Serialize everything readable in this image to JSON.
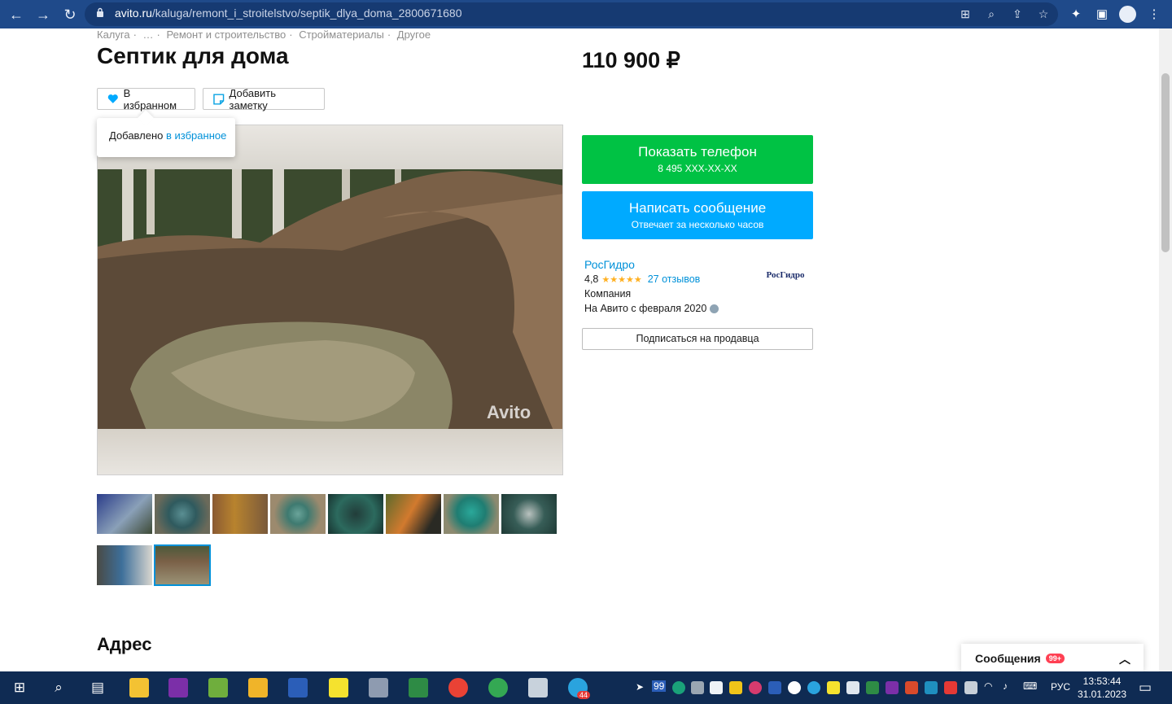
{
  "browser": {
    "url_domain": "avito.ru",
    "url_path": "/kaluga/remont_i_stroitelstvo/septik_dlya_doma_2800671680",
    "icons": [
      "back-arrow-icon",
      "forward-arrow-icon",
      "reload-icon",
      "lock-icon",
      "translate-icon",
      "zoom-icon",
      "share-icon",
      "star-icon",
      "extensions-icon",
      "sidebar-icon",
      "profile-icon",
      "menu-icon"
    ]
  },
  "breadcrumb": [
    "Калуга",
    "…",
    "Ремонт и строительство",
    "Стройматериалы",
    "Другое"
  ],
  "listing": {
    "title": "Септик для дома",
    "price": "110 900 ₽",
    "favorite_label": "В избранном",
    "note_label": "Добавить заметку",
    "tooltip_text": "Добавлено ",
    "tooltip_link": "в избранное",
    "watermark": "Avito",
    "thumbnails_count": 10,
    "selected_thumbnail": 10
  },
  "contact": {
    "phone_button": "Показать телефон",
    "phone_number": "8 495 XXX-XX-XX",
    "message_button": "Написать сообщение",
    "message_sub": "Отвечает за несколько часов"
  },
  "seller": {
    "name": "РосГидро",
    "rating": "4,8",
    "stars": "★★★★★",
    "reviews": "27 отзывов",
    "type": "Компания",
    "since": "На Авито с февраля 2020",
    "logo_text": "РосГидро",
    "subscribe_button": "Подписаться на продавца"
  },
  "sections": {
    "address_heading": "Адрес"
  },
  "messages_widget": {
    "label": "Сообщения",
    "badge": "99+"
  },
  "taskbar": {
    "tray_count": "99",
    "telegram_badge": "44",
    "language": "РУС",
    "time": "13:53:44",
    "date": "31.01.2023"
  },
  "colors": {
    "chrome": "#1f4a8a",
    "green_button": "#00c244",
    "blue_button": "#00aaff",
    "link": "#0091d9",
    "taskbar": "#0f2b53"
  }
}
